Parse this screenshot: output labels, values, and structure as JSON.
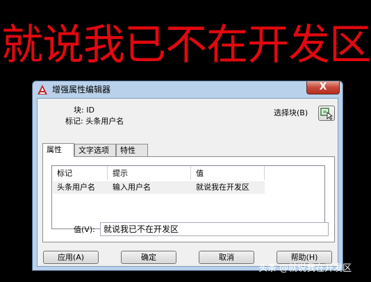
{
  "headline": "就说我已不在开发区",
  "dialog": {
    "title": "增强属性编辑器",
    "close_symbol": "X",
    "block_label": "块: ID",
    "tag_label": "标记: 头条用户名",
    "select_block_label": "选择块(B)",
    "tabs": [
      {
        "label": "属性",
        "active": true
      },
      {
        "label": "文字选项",
        "active": false
      },
      {
        "label": "特性",
        "active": false
      }
    ],
    "attribute_list": {
      "columns": [
        "标记",
        "提示",
        "值"
      ],
      "rows": [
        {
          "tag": "头条用户名",
          "prompt": "输入用户名",
          "value": "就说我在开发区"
        }
      ]
    },
    "value_label": "值(V):",
    "value_input": "就说我已不在开发区",
    "buttons": {
      "apply": "应用(A)",
      "ok": "确定",
      "cancel": "取消",
      "help": "帮助(H)"
    }
  },
  "watermark": "头条 @就说我在开发区",
  "colors": {
    "headline": "#e0090f",
    "window_frame": "#b9d1ea",
    "close_button": "#c8483a",
    "background": "#000000"
  }
}
